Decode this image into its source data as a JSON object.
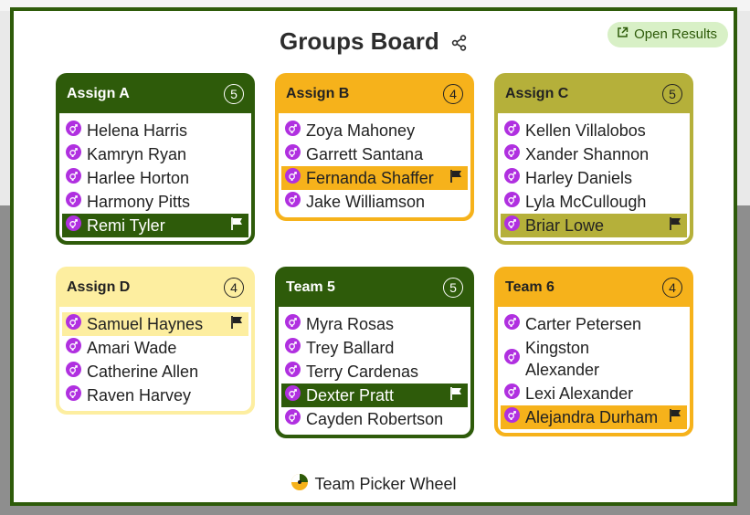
{
  "header": {
    "title": "Groups Board",
    "open_results_label": "Open Results"
  },
  "footer": {
    "brand": "Team Picker Wheel"
  },
  "colors": {
    "dark_green": "#2e5b0a",
    "amber": "#f6b21b",
    "olive": "#b5b03a",
    "pale_yellow": "#fdeea0",
    "purple": "#b030e0"
  },
  "groups": [
    {
      "name": "Assign A",
      "count": "5",
      "theme": "dark_green",
      "members": [
        {
          "name": "Helena Harris"
        },
        {
          "name": "Kamryn Ryan"
        },
        {
          "name": "Harlee Horton"
        },
        {
          "name": "Harmony Pitts"
        },
        {
          "name": "Remi Tyler",
          "leader": true
        }
      ]
    },
    {
      "name": "Assign B",
      "count": "4",
      "theme": "amber",
      "members": [
        {
          "name": "Zoya Mahoney"
        },
        {
          "name": "Garrett Santana"
        },
        {
          "name": "Fernanda Shaffer",
          "leader": true
        },
        {
          "name": "Jake Williamson"
        }
      ]
    },
    {
      "name": "Assign C",
      "count": "5",
      "theme": "olive",
      "members": [
        {
          "name": "Kellen Villalobos"
        },
        {
          "name": "Xander Shannon"
        },
        {
          "name": "Harley Daniels"
        },
        {
          "name": "Lyla McCullough"
        },
        {
          "name": "Briar Lowe",
          "leader": true
        }
      ]
    },
    {
      "name": "Assign D",
      "count": "4",
      "theme": "pale_yellow",
      "members": [
        {
          "name": "Samuel Haynes",
          "leader": true
        },
        {
          "name": "Amari Wade"
        },
        {
          "name": "Catherine Allen"
        },
        {
          "name": "Raven Harvey"
        }
      ]
    },
    {
      "name": "Team 5",
      "count": "5",
      "theme": "dark_green",
      "members": [
        {
          "name": "Myra Rosas"
        },
        {
          "name": "Trey Ballard"
        },
        {
          "name": "Terry Cardenas"
        },
        {
          "name": "Dexter Pratt",
          "leader": true
        },
        {
          "name": "Cayden Robertson"
        }
      ]
    },
    {
      "name": "Team 6",
      "count": "4",
      "theme": "amber",
      "members": [
        {
          "name": "Carter Petersen"
        },
        {
          "name": "Kingston Alexander"
        },
        {
          "name": "Lexi Alexander"
        },
        {
          "name": "Alejandra Durham",
          "leader": true
        }
      ]
    }
  ]
}
